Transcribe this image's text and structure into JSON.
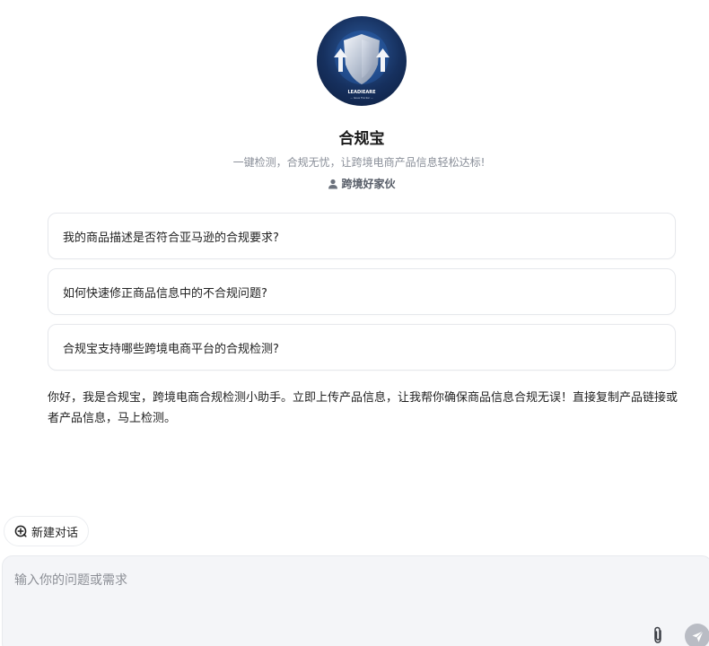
{
  "bot": {
    "name": "合规宝",
    "description": "一键检测，合规无忧，让跨境电商产品信息轻松达标!",
    "author": "跨境好家伙",
    "logo_text": "LEADIEARE",
    "logo_subtext": "— Issue Tracker —"
  },
  "suggestions": [
    {
      "label": "我的商品描述是否符合亚马逊的合规要求?"
    },
    {
      "label": "如何快速修正商品信息中的不合规问题?"
    },
    {
      "label": "合规宝支持哪些跨境电商平台的合规检测?"
    }
  ],
  "greeting": "你好，我是合规宝，跨境电商合规检测小助手。立即上传产品信息，让我帮你确保商品信息合规无误！直接复制产品链接或者产品信息，马上检测。",
  "new_chat": {
    "label": "新建对话"
  },
  "composer": {
    "placeholder": "输入你的问题或需求",
    "value": ""
  },
  "icons": {
    "avatar": "shield-logo-icon",
    "author": "user-icon",
    "new_chat": "add-chat-icon",
    "attach": "paperclip-icon",
    "send": "send-icon"
  },
  "colors": {
    "send_button": "#b9bcc4",
    "composer_bg": "#f4f5f8",
    "muted_text": "#8a8f99"
  }
}
